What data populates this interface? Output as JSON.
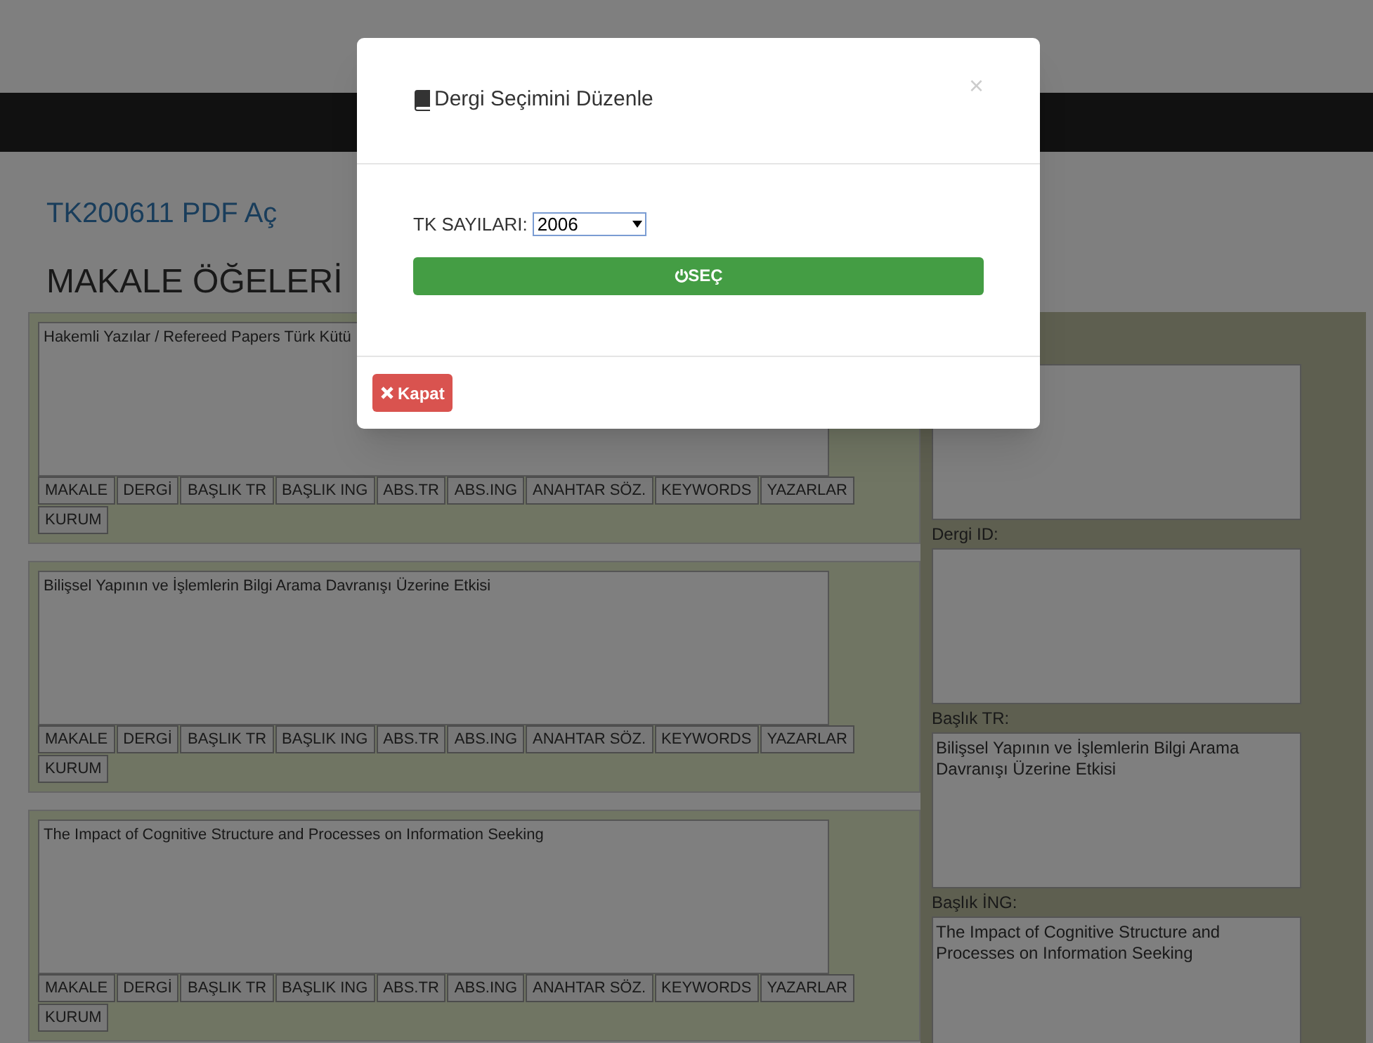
{
  "page": {
    "pdf_link": "TK200611 PDF Aç",
    "heading": "MAKALE ÖĞELERİ"
  },
  "items": [
    {
      "text": "Hakemli Yazılar / Refereed Papers Türk Kütü",
      "buttons": [
        "MAKALE",
        "DERGİ",
        "BAŞLIK TR",
        "BAŞLIK ING",
        "ABS.TR",
        "ABS.ING",
        "ANAHTAR SÖZ.",
        "KEYWORDS",
        "YAZARLAR",
        "KURUM"
      ]
    },
    {
      "text": "Bilişsel Yapının ve İşlemlerin Bilgi Arama Davranışı Üzerine Etkisi",
      "buttons": [
        "MAKALE",
        "DERGİ",
        "BAŞLIK TR",
        "BAŞLIK ING",
        "ABS.TR",
        "ABS.ING",
        "ANAHTAR SÖZ.",
        "KEYWORDS",
        "YAZARLAR",
        "KURUM"
      ]
    },
    {
      "text": "The Impact of Cognitive Structure and Processes on Information Seeking",
      "buttons": [
        "MAKALE",
        "DERGİ",
        "BAŞLIK TR",
        "BAŞLIK ING",
        "ABS.TR",
        "ABS.ING",
        "ANAHTAR SÖZ.",
        "KEYWORDS",
        "YAZARLAR",
        "KURUM"
      ]
    }
  ],
  "side_fields": [
    {
      "kind": "unlabeled"
    },
    {
      "kind": "labeled",
      "label": "Dergi ID:"
    },
    {
      "kind": "labeled",
      "label": "Başlık TR:",
      "value": "Bilişsel Yapının ve İşlemlerin Bilgi Arama Davranışı Üzerine Etkisi"
    },
    {
      "kind": "labeled",
      "label": "Başlık İNG:",
      "value": "The Impact of Cognitive Structure and Processes on Information Seeking"
    }
  ],
  "modal": {
    "title": "Dergi Seçimini Düzenle",
    "close": "×",
    "field": {
      "label": "TK SAYILARI:",
      "value": "2006"
    },
    "select_button": "SEÇ",
    "close_button": "Kapat"
  }
}
